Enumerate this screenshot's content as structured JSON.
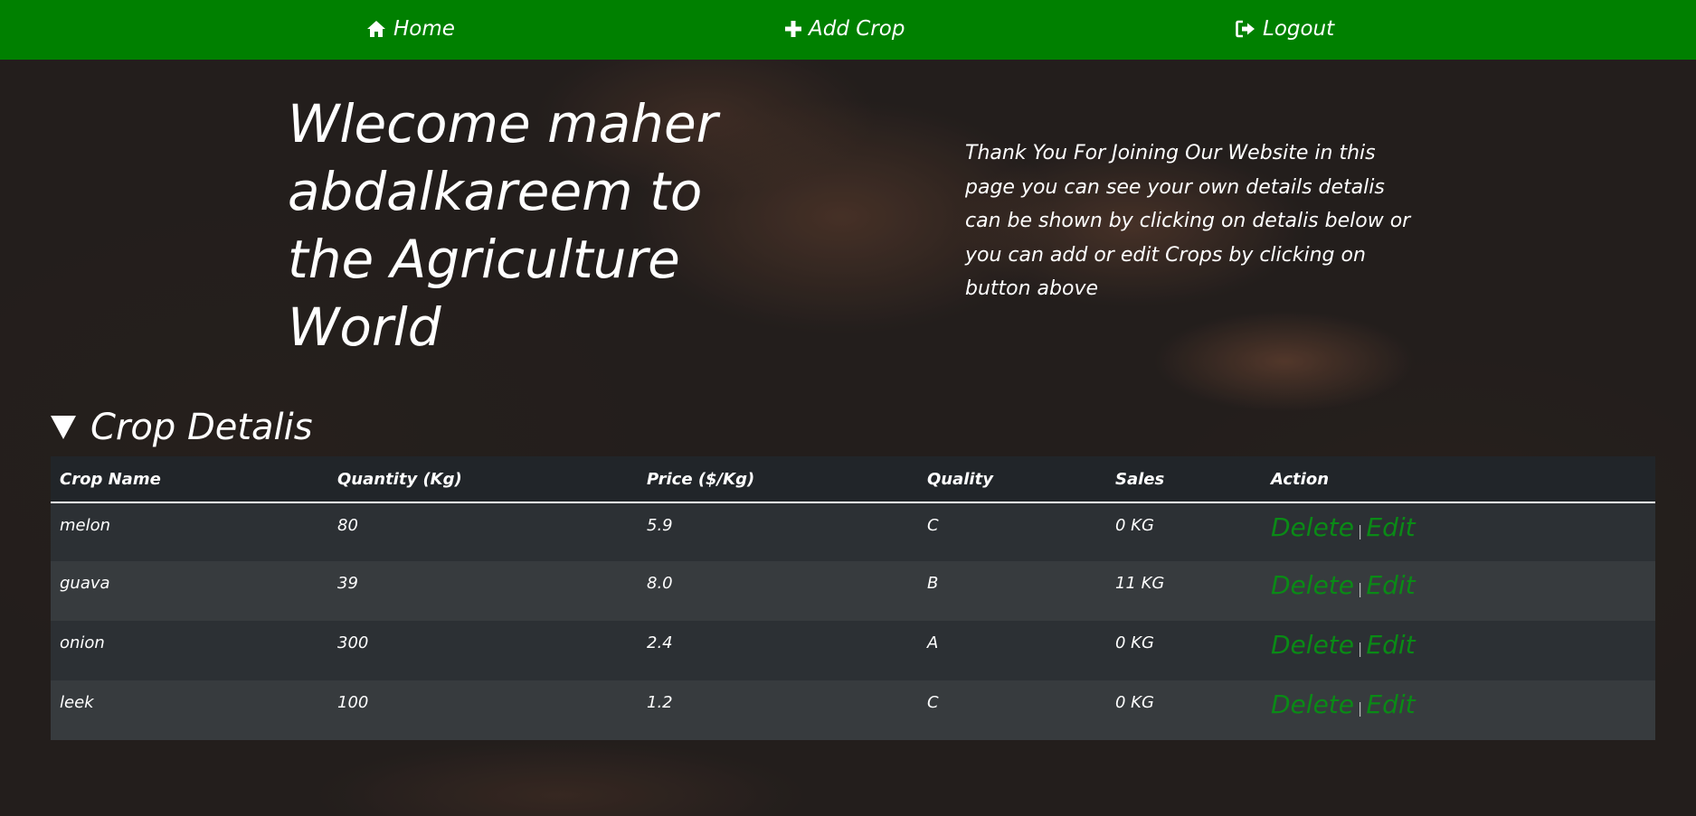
{
  "colors": {
    "nav_background": "#008000",
    "link_green": "#0a8a16",
    "table_header_bg": "#212529",
    "table_row_odd": "#2c3034",
    "table_row_even": "#373b3e"
  },
  "nav": {
    "items": [
      {
        "label": "Home",
        "icon": "home-icon"
      },
      {
        "label": "Add Crop",
        "icon": "plus-icon"
      },
      {
        "label": "Logout",
        "icon": "sign-out-icon"
      }
    ]
  },
  "hero": {
    "welcome": "Wlecome maher abdalkareem to the Agriculture World",
    "intro": "Thank You For Joining Our Website in this page you can see your own details detalis can be shown by clicking on detalis below or you can add or edit Crops by clicking on button above"
  },
  "details": {
    "summary_label": "Crop Detalis",
    "expanded": true
  },
  "table": {
    "headers": [
      "Crop Name",
      "Quantity (Kg)",
      "Price ($/Kg)",
      "Quality",
      "Sales",
      "Action"
    ],
    "rows": [
      {
        "name": "melon",
        "quantity": "80",
        "price": "5.9",
        "quality": "C",
        "sales": "0 KG"
      },
      {
        "name": "guava",
        "quantity": "39",
        "price": "8.0",
        "quality": "B",
        "sales": "11 KG"
      },
      {
        "name": "onion",
        "quantity": "300",
        "price": "2.4",
        "quality": "A",
        "sales": "0 KG"
      },
      {
        "name": "leek",
        "quantity": "100",
        "price": "1.2",
        "quality": "C",
        "sales": "0 KG"
      }
    ],
    "delete_label": "Delete",
    "separator": "|",
    "edit_label": "Edit"
  }
}
